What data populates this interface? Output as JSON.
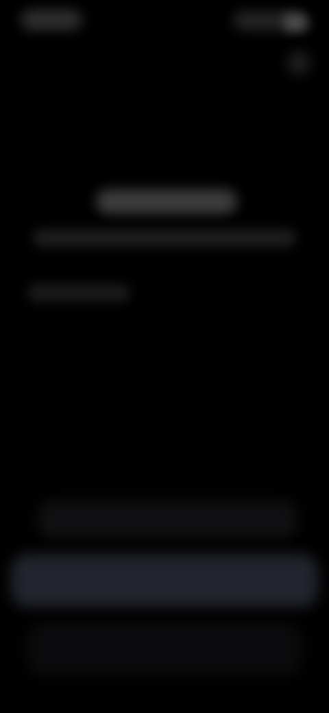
{
  "app": {
    "background_color": "#000000"
  },
  "status_bar": {
    "time": "",
    "battery_icon": "battery-icon",
    "signal_icon": "signal-icon"
  },
  "corner_action": {
    "icon": "more-icon"
  },
  "content": {
    "title": "",
    "subtitle": "",
    "caption": ""
  },
  "actions": {
    "option_label": "",
    "primary_label": "",
    "secondary_label": ""
  },
  "colors": {
    "primary_button": "#22252d",
    "secondary_button": "#0b0b0d"
  }
}
